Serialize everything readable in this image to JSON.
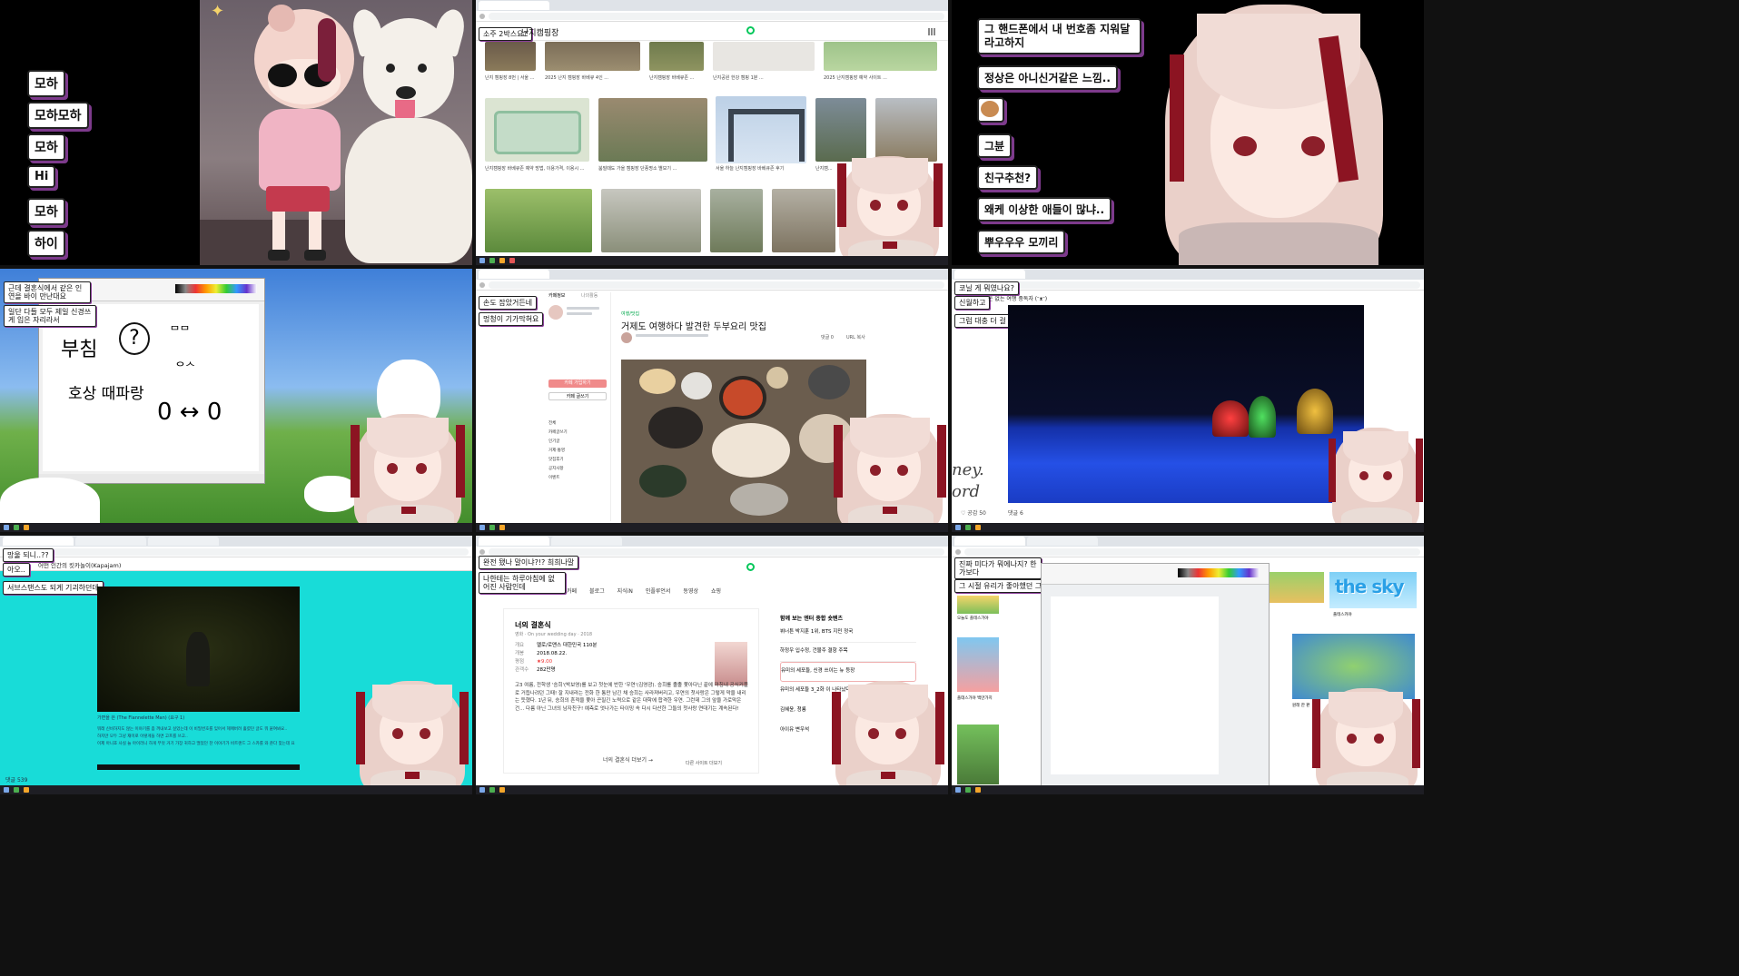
{
  "panel1": {
    "bubbles": [
      "모하",
      "모하모하",
      "모하",
      "Hi",
      "모하",
      "하이"
    ]
  },
  "panel2": {
    "search_badge": "소주 2박스요?",
    "search_query": "난지캠핑장",
    "captions_row1": [
      "난지 캠핑장 8번 | 서울 ...",
      "2025 난지 캠핑장 바베큐 4인 ...",
      "난지캠핑장 바베큐존 ...",
      "난지공원 한강 캠핑 1분 ...",
      "2025 난지캠핑장 예약 사이트 ..."
    ],
    "captions_row2": [
      "난지캠핑장 바베큐존 예약 방법, 이용가격, 이용시 ...",
      "붐빌때도 가을 캠핑장 단풍명소 별보기 ...",
      "서울 하늘 난지캠핑장 바베큐존 후기",
      "난지캠..."
    ]
  },
  "panel3": {
    "bubbles": [
      "그 핸드폰에서 내 번호좀 지워달라고하지",
      "정상은 아니신거같은 느낌..",
      "그뷴",
      "친구추천?",
      "왜케 이상한 애들이 많냐..",
      "뿌우우우 모끼리"
    ]
  },
  "panel4": {
    "chat": [
      "근데 결혼식에서 같은 인연을 바이 만난대요",
      "일단 다들 모두 제일 신경쓰게 입은 자리라서"
    ],
    "doodles": [
      "부침",
      "?",
      "ᄆᄆ",
      "ᄋᄉ",
      "호상 때파랑",
      "0 ↔ 0"
    ]
  },
  "panel5": {
    "chat": [
      "손도 잡았거든네",
      "멍청이 기가막혀요"
    ],
    "tabs": [
      "카페정보",
      "나의활동"
    ],
    "menu": [
      "전체",
      "카페글쓰기",
      "인기글",
      "거제·통영",
      "맛집후기",
      "공지사항",
      "이벤트"
    ],
    "category": "여행/맛집",
    "title": "거제도 여행하다 발견한 두부요리 맛집",
    "join_label": "카페 가입하기",
    "write_label": "카페 글쓰기",
    "comment_label": "댓글 0",
    "url_label": "URL 복사"
  },
  "panel6": {
    "chat": [
      "코닐 게 뭐였나요?",
      "신월하고",
      "그럼 대충 더 걸 나오죠"
    ],
    "blog_title": "돈 없는 여행 중독자 (ᵔᴥᵔ)",
    "side_text": [
      "ney.",
      "ord"
    ],
    "like_label": "공감 50",
    "comment_label": "댓글 6"
  },
  "panel7": {
    "chat": [
      "망울 되니..??",
      "아오..",
      "서브스탠스도 되게 기괴하던데"
    ],
    "blog_title": "어떤 인간의 킷카놀이(Kapajam)",
    "caption": "가면을 쓴 (The Flannelette Man) (요구 1)",
    "body": [
      "뭐래 신비하지도 않는 이야기를 좀 꺼내보고 싶었는데 이 비밀번호를 잊어서 헤매버려 홀렸던 글도 뭐 붙여봐요..",
      "하지만 모두 그냥 재미로 이렇게들 하면 고프를 쓰고..",
      "이제 아니죠 사실 늘 아이러니 하게 무엇 거기 가장 귀하고 떨었던 찬 이야기가 비트랜드 그 스카를 와 준다 맞는데 요"
    ],
    "comment_label": "댓글 539"
  },
  "panel8": {
    "chat": [
      "완전 됐나 말이냐?!? 희희나말",
      "나한테는 하루아침에 없어진 사람인데"
    ],
    "tabs": [
      "카페",
      "블로그",
      "지식iN",
      "인플루언서",
      "동영상",
      "쇼핑"
    ],
    "movie_title": "너의 결혼식",
    "movie_sub": "영화 · On your wedding day · 2018",
    "info_keys": [
      "개요",
      "개봉",
      "평점",
      "관객수"
    ],
    "info_vals": [
      "멜로/로맨스  대한민국  110분",
      "2018.08.22.",
      "★9.00",
      "282만명"
    ],
    "synopsis": "고3 여름, 전학생 '승희'(박보영)를 보고 첫눈에 반한 '우연'(김영광). 승희를 졸졸 쫓아다닌 끝에 마침내 공식커플로 거듭나려던 그때! 잘 지내라는 전화 한 통만 남긴 채 승희는 사라져버리고, 우연의 첫사랑은 그렇게 막을 내리는 듯했다. 1년 뒤, 승희의 흔적을 쫓아 끈질긴 노력으로 같은 대학에 합격한 우연. 그런데 그의 앞을 가로막은 건... 다름 아닌 그녀의 남자친구! 예측로 엇나가는 타이밍 속 다시 다산한 그들의 첫사랑 연대기는 계속된다!",
    "more_site": "다른 사이트 더보기",
    "more_link": "너의 결혼식 더보기 →",
    "related_title": "함께 보는 엔터 종합 숏텐츠",
    "related": [
      "뷔너튼 박지훈 1위, BTS 지민 정국",
      "하정우 입수정, 건물주 결항 주목",
      "유미의 세포들, 신경 쓰이는 뉴 등장",
      "유미의 세포들 3_2화 이 나타났다",
      "김혜윤, 청룡",
      "아이유 변우석"
    ]
  },
  "panel9": {
    "chat": [
      "진짜 미다가 뭐에나지? 한가보다",
      "그 시절 유리가 좋아했던 그니.."
    ],
    "game_title": "the sky",
    "captions": [
      "오늘도 플테스가야",
      "플데스가야 백만가치",
      "풀테스카야",
      "원래 한 판"
    ]
  },
  "colors": {
    "bubble_shadow": "#7d3a8c",
    "naver_green": "#03c75a",
    "ribbon": "#8c1422"
  }
}
